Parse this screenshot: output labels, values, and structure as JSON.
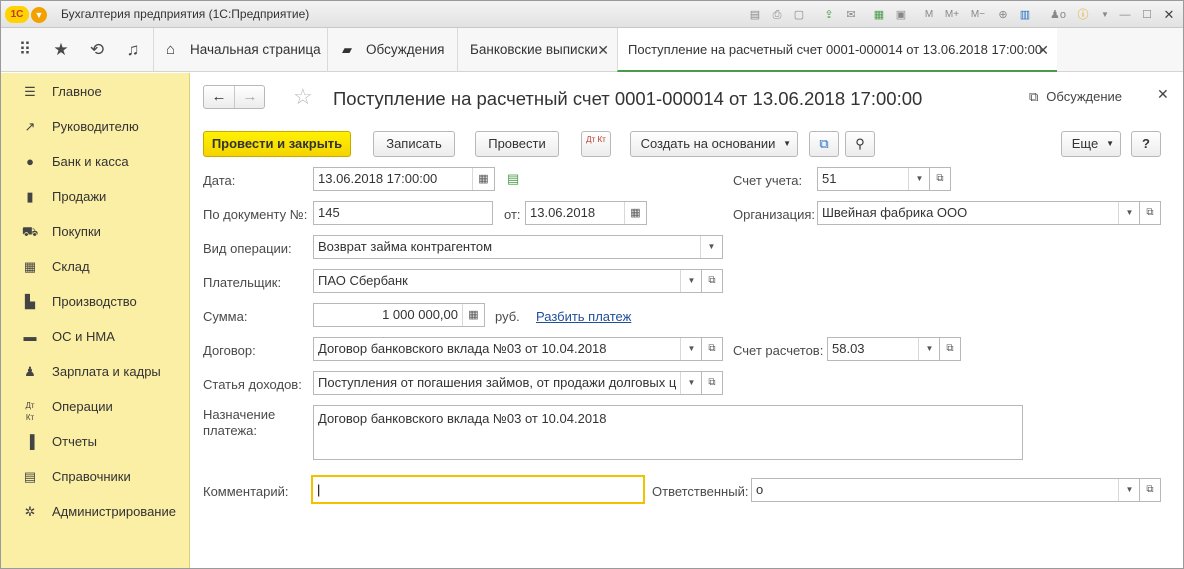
{
  "app": {
    "title": "Бухгалтерия предприятия  (1С:Предприятие)",
    "logo": "1С"
  },
  "tabs": {
    "home": "Начальная страница",
    "discussions": "Обсуждения",
    "bank": "Банковские выписки",
    "doc": "Поступление на расчетный счет 0001-000014 от 13.06.2018 17:00:00"
  },
  "sidebar": {
    "items": [
      {
        "label": "Главное",
        "icon": "menu-icon"
      },
      {
        "label": "Руководителю",
        "icon": "chart-trend-icon"
      },
      {
        "label": "Банк и касса",
        "icon": "coin-icon"
      },
      {
        "label": "Продажи",
        "icon": "bag-icon"
      },
      {
        "label": "Покупки",
        "icon": "cart-icon"
      },
      {
        "label": "Склад",
        "icon": "grid-icon"
      },
      {
        "label": "Производство",
        "icon": "factory-icon"
      },
      {
        "label": "ОС и НМА",
        "icon": "truck-icon"
      },
      {
        "label": "Зарплата и кадры",
        "icon": "person-icon"
      },
      {
        "label": "Операции",
        "icon": "dt-kt-icon"
      },
      {
        "label": "Отчеты",
        "icon": "bar-chart-icon"
      },
      {
        "label": "Справочники",
        "icon": "book-icon"
      },
      {
        "label": "Администрирование",
        "icon": "gear-icon"
      }
    ]
  },
  "doc": {
    "title": "Поступление на расчетный счет 0001-000014 от 13.06.2018 17:00:00",
    "discussion": "Обсуждение"
  },
  "toolbar": {
    "post_close": "Провести и закрыть",
    "save": "Записать",
    "post": "Провести",
    "dtkt": "Дт Кт",
    "create_based": "Создать на основании",
    "more": "Еще",
    "help": "?"
  },
  "form": {
    "date_label": "Дата:",
    "date_value": "13.06.2018 17:00:00",
    "account_label": "Счет учета:",
    "account_value": "51",
    "docnum_label": "По документу №:",
    "docnum_value": "145",
    "from_label": "от:",
    "from_value": "13.06.2018",
    "org_label": "Организация:",
    "org_value": "Швейная фабрика ООО",
    "optype_label": "Вид операции:",
    "optype_value": "Возврат займа контрагентом",
    "payer_label": "Плательщик:",
    "payer_value": "ПАО Сбербанк",
    "sum_label": "Сумма:",
    "sum_value": "1 000 000,00",
    "currency": "руб.",
    "split_link": "Разбить платеж",
    "contract_label": "Договор:",
    "contract_value": "Договор банковского вклада №03 от 10.04.2018",
    "settle_label": "Счет расчетов:",
    "settle_value": "58.03",
    "income_label": "Статья доходов:",
    "income_value": "Поступления от погашения займов, от продажи долговых це",
    "purpose_label_1": "Назначение",
    "purpose_label_2": "платежа:",
    "purpose_value": "Договор банковского вклада №03 от 10.04.2018",
    "comment_label": "Комментарий:",
    "comment_value": "",
    "responsible_label": "Ответственный:",
    "responsible_value": "о"
  }
}
